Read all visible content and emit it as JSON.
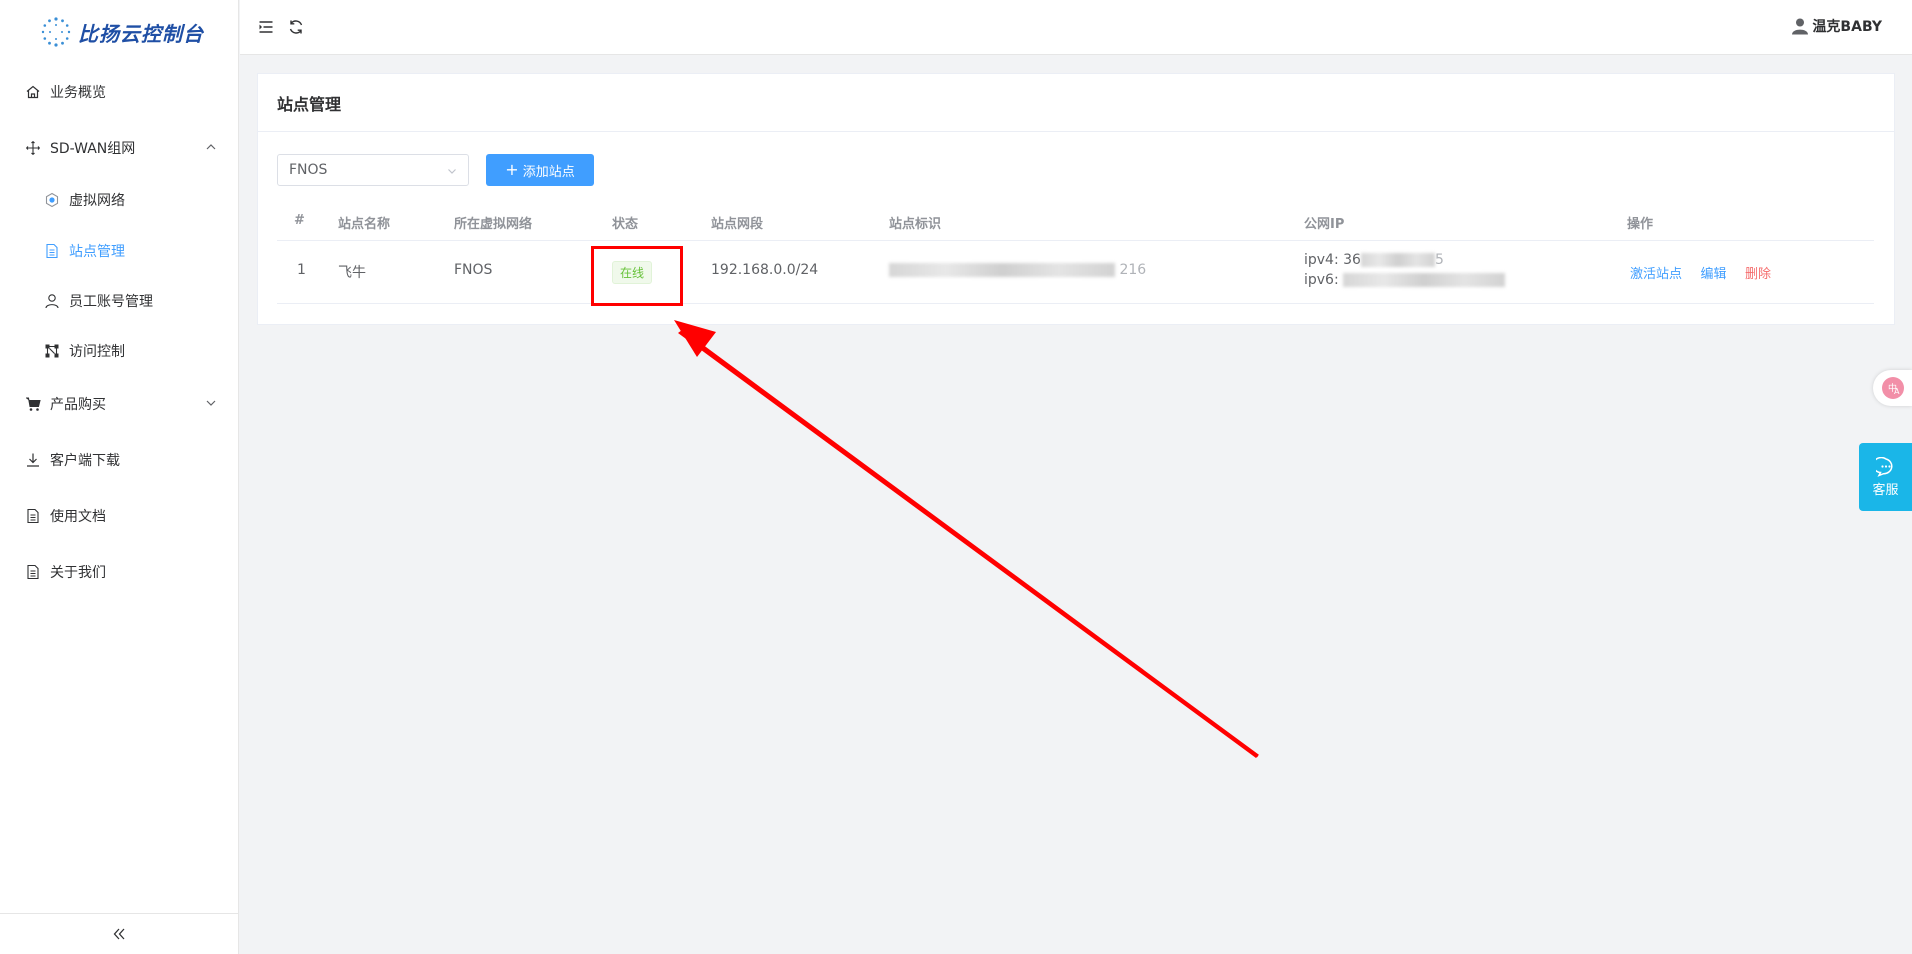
{
  "app": {
    "title": "比扬云控制台"
  },
  "sidebar": {
    "items": [
      {
        "label": "业务概览"
      },
      {
        "label": "SD-WAN组网"
      },
      {
        "label": "虚拟网络"
      },
      {
        "label": "站点管理"
      },
      {
        "label": "员工账号管理"
      },
      {
        "label": "访问控制"
      },
      {
        "label": "产品购买"
      },
      {
        "label": "客户端下载"
      },
      {
        "label": "使用文档"
      },
      {
        "label": "关于我们"
      }
    ],
    "active_item": "站点管理"
  },
  "header": {
    "user_name": "温克BABY"
  },
  "page": {
    "title": "站点管理",
    "network_select": {
      "value": "FNOS"
    },
    "add_button_label": "添加站点"
  },
  "table": {
    "columns": [
      "#",
      "站点名称",
      "所在虚拟网络",
      "状态",
      "站点网段",
      "站点标识",
      "公网IP",
      "操作"
    ],
    "rows": [
      {
        "index": "1",
        "name": "飞牛",
        "network": "FNOS",
        "status": "在线",
        "subnet": "192.168.0.0/24",
        "identifier_suffix": "216",
        "ipv4_label": "ipv4:",
        "ipv4_prefix": "36",
        "ipv4_suffix": "5",
        "ipv6_label": "ipv6:",
        "actions": [
          "激活站点",
          "编辑",
          "删除"
        ]
      }
    ]
  },
  "float": {
    "service_label": "客服"
  },
  "colors": {
    "primary": "#409eff",
    "success": "#67c23a",
    "danger": "#f56c6c",
    "annotation": "#ff0000"
  }
}
